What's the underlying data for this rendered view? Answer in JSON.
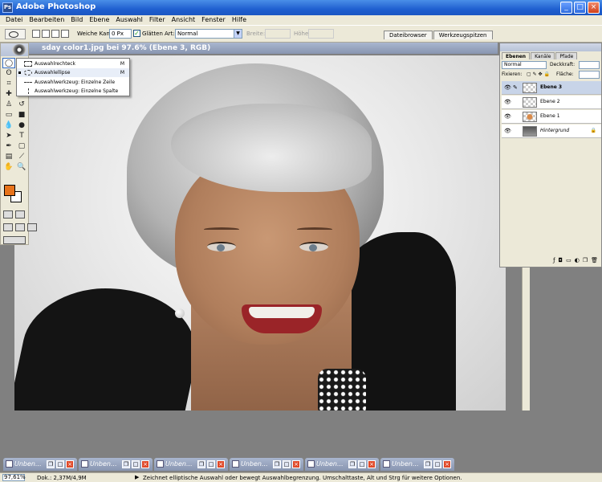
{
  "window": {
    "title": "Adobe Photoshop",
    "app_icon": "Ps"
  },
  "menu": [
    "Datei",
    "Bearbeiten",
    "Bild",
    "Ebene",
    "Auswahl",
    "Filter",
    "Ansicht",
    "Fenster",
    "Hilfe"
  ],
  "options": {
    "feather_label": "Weiche Kante:",
    "feather_value": "0 Px",
    "antialias_label": "Glätten",
    "style_label": "Art:",
    "style_value": "Normal",
    "width_label": "Breite:",
    "height_label": "Höhe:",
    "palette_tabs": [
      "Dateibrowser",
      "Werkzeugspitzen"
    ]
  },
  "document": {
    "title": "sday color1.jpg bei 97.6% (Ebene 3, RGB)"
  },
  "colors": {
    "foreground": "#e8731a",
    "background": "#ffffff"
  },
  "flyout": {
    "items": [
      {
        "label": "Auswahlrechteck",
        "key": "M",
        "icon": "rect-marquee-icon"
      },
      {
        "label": "Auswahlellipse",
        "key": "M",
        "icon": "ellipse-marquee-icon",
        "selected": true
      },
      {
        "label": "Auswahlwerkzeug: Einzelne Zeile",
        "key": "",
        "icon": "single-row-icon"
      },
      {
        "label": "Auswahlwerkzeug: Einzelne Spalte",
        "key": "",
        "icon": "single-column-icon"
      }
    ]
  },
  "layers_panel": {
    "tabs": [
      "Ebenen",
      "Kanäle",
      "Pfade"
    ],
    "blend_mode": "Normal",
    "opacity_label": "Deckkraft:",
    "lock_label": "Fixieren:",
    "fill_label": "Fläche:",
    "layers": [
      {
        "name": "Ebene 3",
        "active": true
      },
      {
        "name": "Ebene 2",
        "active": false
      },
      {
        "name": "Ebene 1",
        "active": false
      },
      {
        "name": "Hintergrund",
        "active": false,
        "locked": true
      }
    ]
  },
  "minimized_docs": [
    "Unben...",
    "Unben...",
    "Unben...",
    "Unben...",
    "Unben...",
    "Unben..."
  ],
  "status": {
    "zoom": "97,61%",
    "doc_size": "Dok.: 2,37M/4,9M",
    "hint": "Zeichnet elliptische Auswahl oder bewegt Auswahlbegrenzung. Umschalttaste, Alt und Strg für weitere Optionen."
  }
}
